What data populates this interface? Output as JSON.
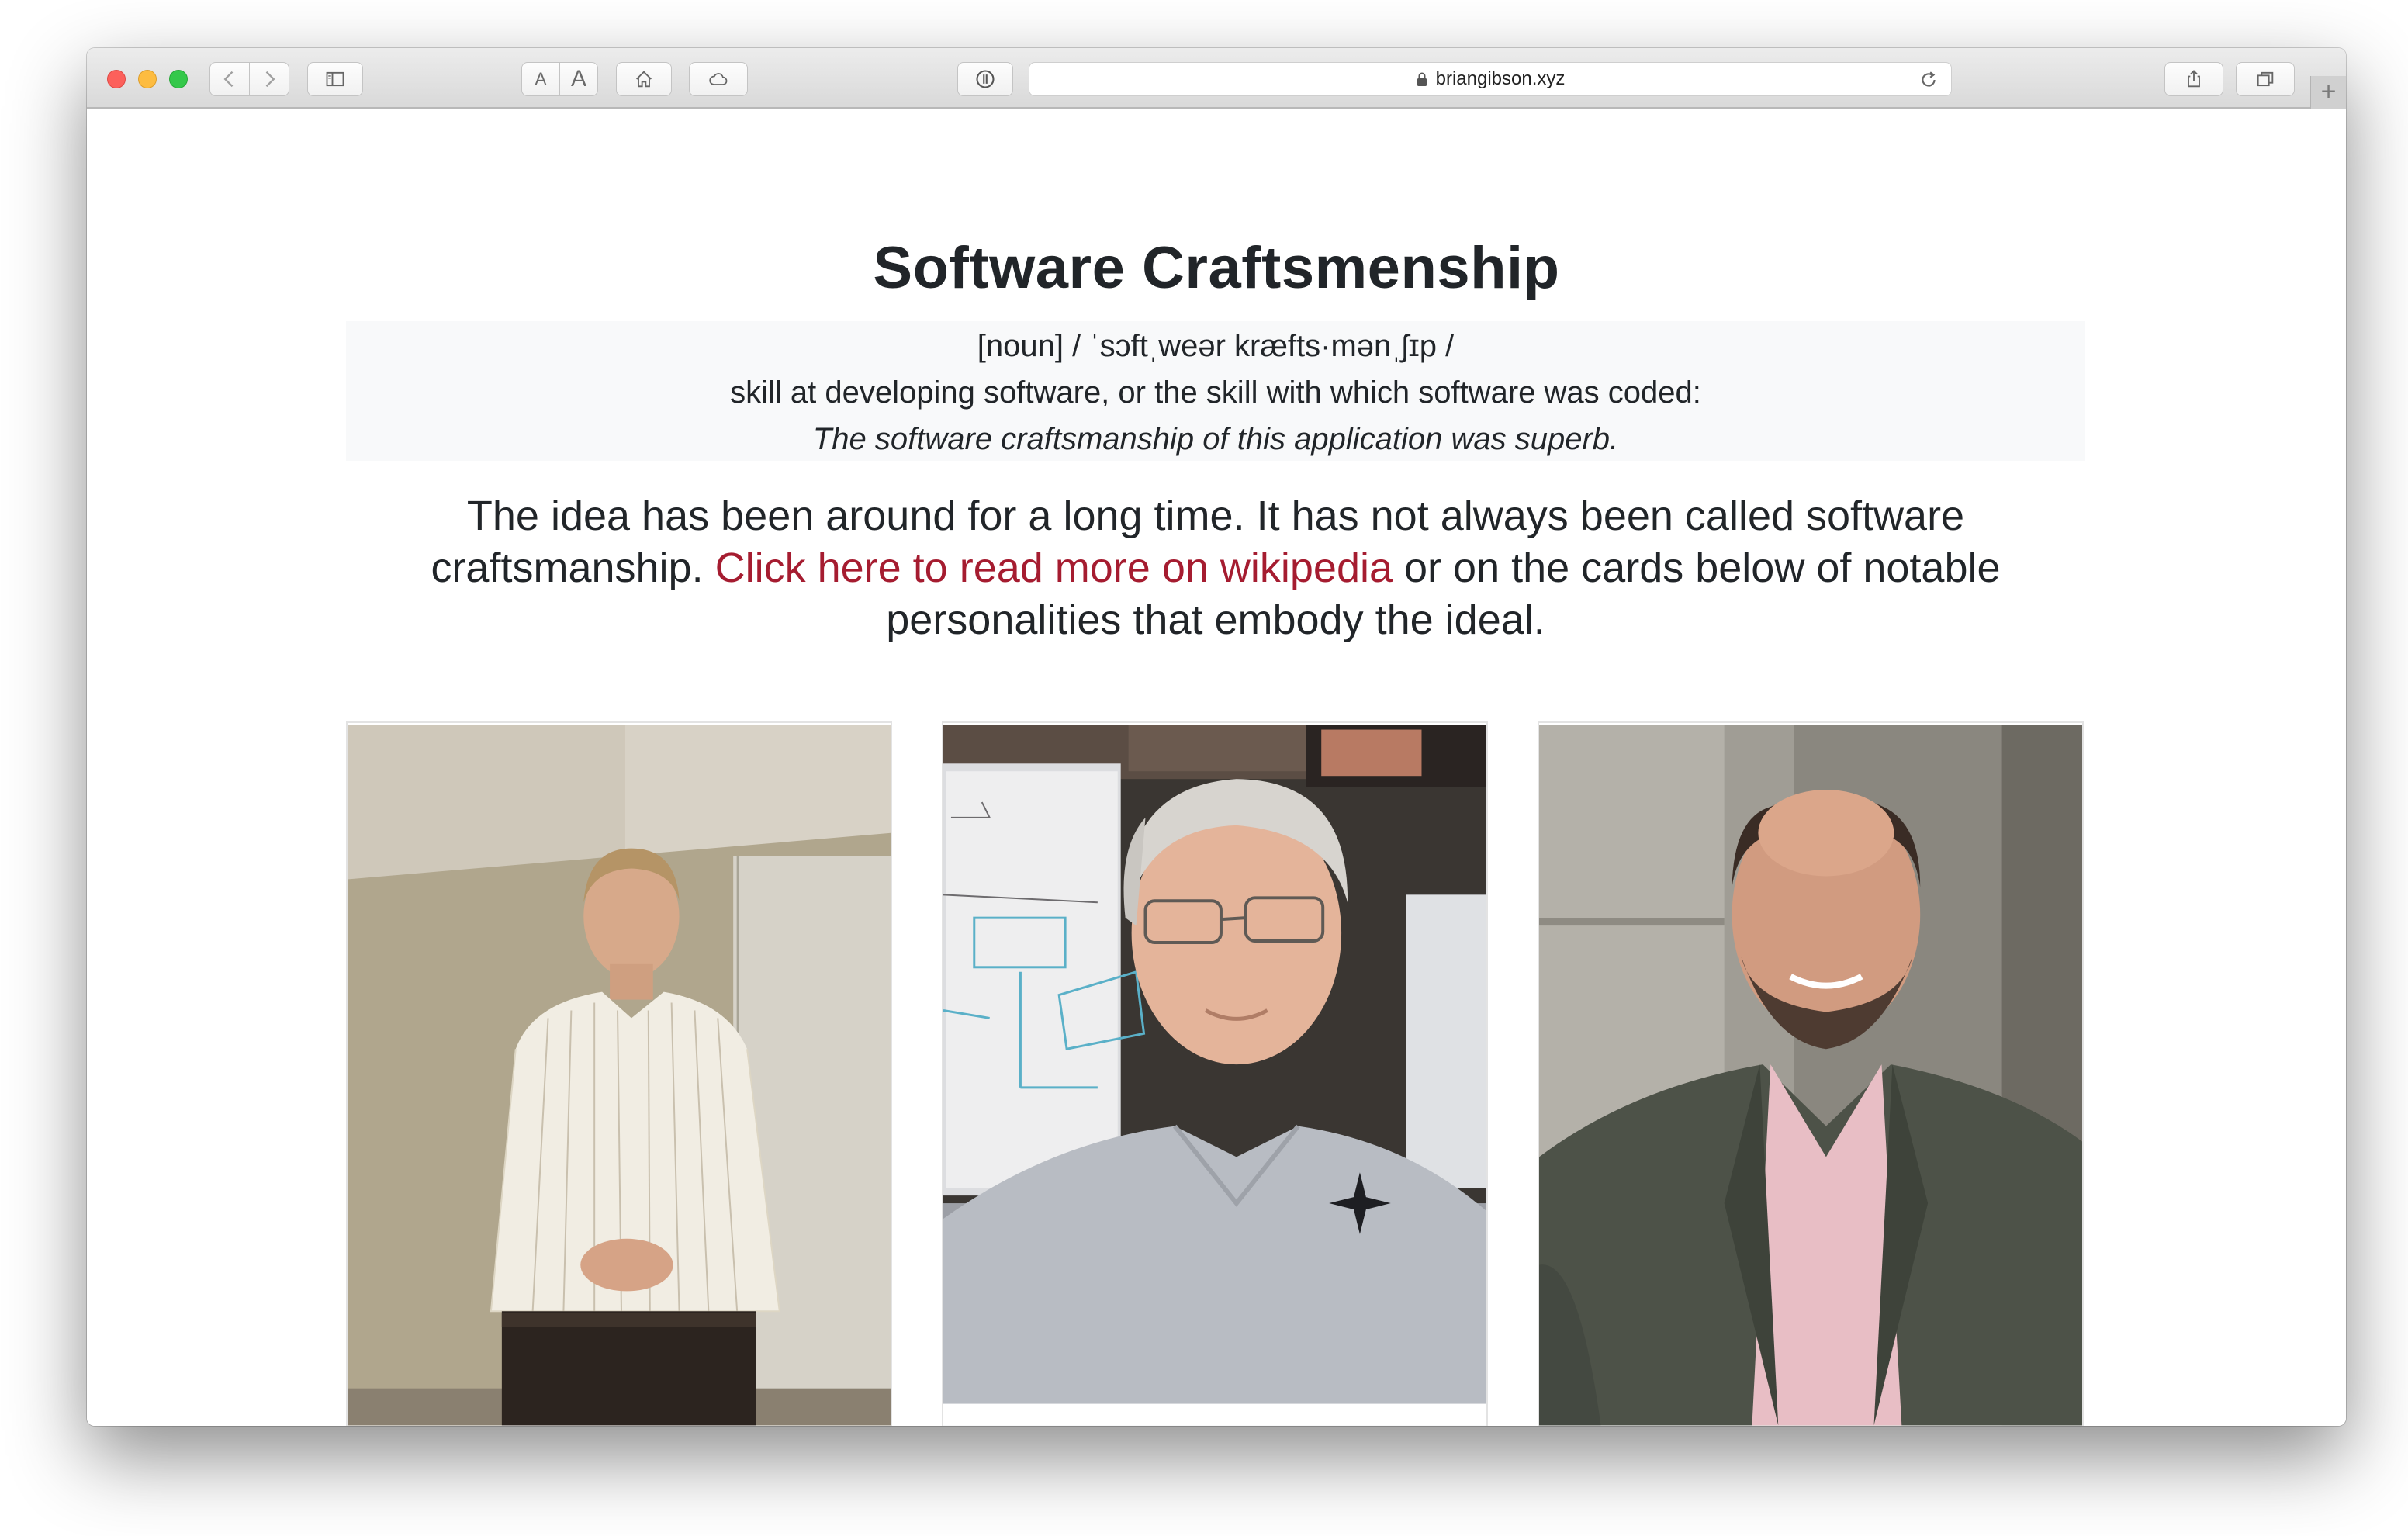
{
  "browser": {
    "url": "briangibson.xyz",
    "text_smaller": "A",
    "text_larger": "A",
    "new_tab": "+"
  },
  "page": {
    "title": "Software Craftsmenship",
    "definition": {
      "pronunciation": "[noun] / ˈsɔftˌweər kræfts·mənˌʃɪp /",
      "meaning": "skill at developing software, or the skill with which software was coded:",
      "example": "The software craftsmanship of this application was superb."
    },
    "lead": {
      "before": "The idea has been around for a long time. It has not always been called software craftsmanship. ",
      "link": "Click here to read more on wikipedia",
      "after": " or on the cards below of notable personalities that embody the ideal."
    }
  },
  "colors": {
    "link": "#a51c30",
    "text": "#212529",
    "definition_bg": "#f8f9fa"
  },
  "icons": [
    "back-icon",
    "forward-icon",
    "sidebar-icon",
    "home-icon",
    "icloud-icon",
    "reader-icon",
    "lock-icon",
    "reload-icon",
    "share-icon",
    "tabs-icon"
  ]
}
